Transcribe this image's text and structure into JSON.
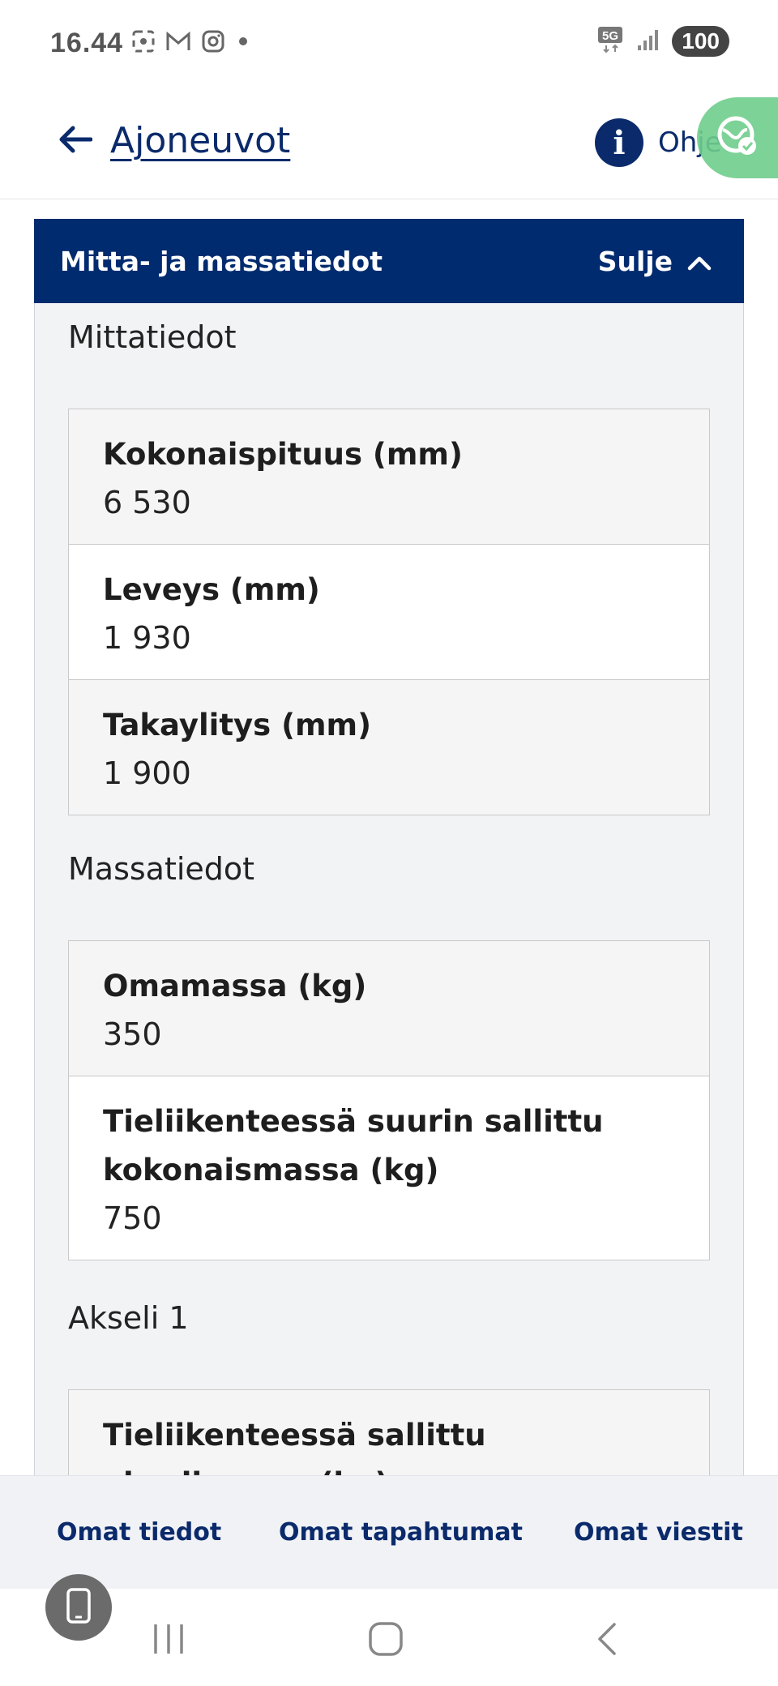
{
  "status_bar": {
    "time": "16.44",
    "network": "5G",
    "battery": "100",
    "icons": [
      "screenshot-icon",
      "gmail-icon",
      "instagram-icon",
      "notification-dot-icon",
      "5g-icon",
      "signal-icon",
      "battery-icon"
    ]
  },
  "header": {
    "back_label": "Ajoneuvot",
    "help_label": "Ohje",
    "info_glyph": "i"
  },
  "panel": {
    "title": "Mitta- ja massatiedot",
    "toggle_label": "Sulje"
  },
  "sections": [
    {
      "title": "Mittatiedot",
      "rows": [
        {
          "label": "Kokonaispituus (mm)",
          "value": "6 530"
        },
        {
          "label": "Leveys (mm)",
          "value": "1 930"
        },
        {
          "label": "Takaylitys (mm)",
          "value": "1 900"
        }
      ]
    },
    {
      "title": "Massatiedot",
      "rows": [
        {
          "label": "Omamassa (kg)",
          "value": "350"
        },
        {
          "label": "Tieliikenteessä suurin sallittu kokonaismassa (kg)",
          "value": "750"
        }
      ]
    },
    {
      "title": "Akseli 1",
      "rows": [
        {
          "label": "Tieliikenteessä sallittu akselimassa (kg)",
          "value": ""
        }
      ]
    }
  ],
  "bottom_nav": {
    "items": [
      "Omat tiedot",
      "Omat tapahtumat",
      "Omat viestit"
    ]
  },
  "colors": {
    "primary": "#002b6f",
    "link": "#0a2a6b",
    "panel_bg": "#f2f3f5",
    "badge_green": "#6fce8c"
  }
}
